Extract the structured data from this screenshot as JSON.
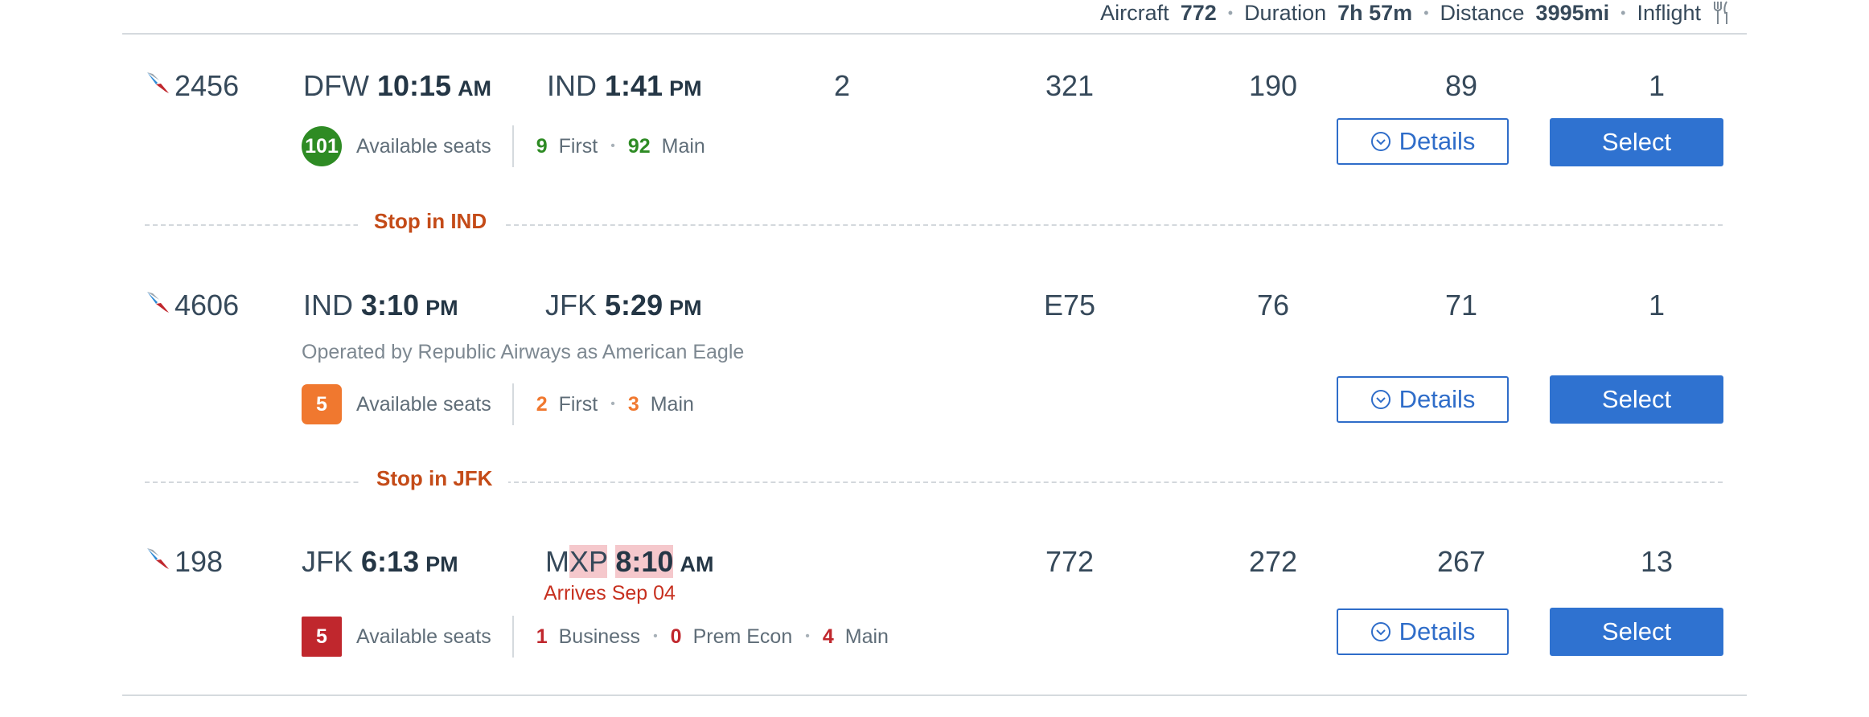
{
  "summary": {
    "aircraft_label": "Aircraft",
    "aircraft_value": "772",
    "duration_label": "Duration",
    "duration_value": "7h 57m",
    "distance_label": "Distance",
    "distance_value": "3995mi",
    "inflight_label": "Inflight",
    "separator": "•"
  },
  "segments": [
    {
      "flight": "2456",
      "dep_city": "DFW",
      "dep_time": "10:15",
      "dep_ampm": "AM",
      "arr_city": "IND",
      "arr_time": "1:41",
      "arr_ampm": "PM",
      "stops": "2",
      "aircraft": "321",
      "c1": "190",
      "c2": "89",
      "c3": "1",
      "seats_total": "101",
      "seats_label": "Available seats",
      "cabins": [
        {
          "count": "9",
          "name": "First"
        },
        {
          "count": "92",
          "name": "Main"
        }
      ],
      "details_label": "Details",
      "select_label": "Select"
    },
    {
      "flight": "4606",
      "dep_city": "IND",
      "dep_time": "3:10",
      "dep_ampm": "PM",
      "arr_city": "JFK",
      "arr_time": "5:29",
      "arr_ampm": "PM",
      "aircraft": "E75",
      "c1": "76",
      "c2": "71",
      "c3": "1",
      "operated_by": "Operated by Republic Airways as American Eagle",
      "seats_total": "5",
      "seats_label": "Available seats",
      "cabins": [
        {
          "count": "2",
          "name": "First"
        },
        {
          "count": "3",
          "name": "Main"
        }
      ],
      "details_label": "Details",
      "select_label": "Select"
    },
    {
      "flight": "198",
      "dep_city": "JFK",
      "dep_time": "6:13",
      "dep_ampm": "PM",
      "arr_city_prefix": "M",
      "arr_city_hl": "XP",
      "arr_time": "8:10",
      "arr_ampm": "AM",
      "arrives_note": "Arrives Sep 04",
      "aircraft": "772",
      "c1": "272",
      "c2": "267",
      "c3": "13",
      "seats_total": "5",
      "seats_label": "Available seats",
      "cabins": [
        {
          "count": "1",
          "name": "Business"
        },
        {
          "count": "0",
          "name": "Prem Econ"
        },
        {
          "count": "4",
          "name": "Main"
        }
      ],
      "details_label": "Details",
      "select_label": "Select"
    }
  ],
  "stops": [
    {
      "label": "Stop in IND"
    },
    {
      "label": "Stop in JFK"
    }
  ],
  "colors": {
    "primary_blue": "#2f72d0",
    "green": "#2e8b24",
    "orange": "#f0782f",
    "red": "#c0272d",
    "stop_text": "#c44b18"
  }
}
